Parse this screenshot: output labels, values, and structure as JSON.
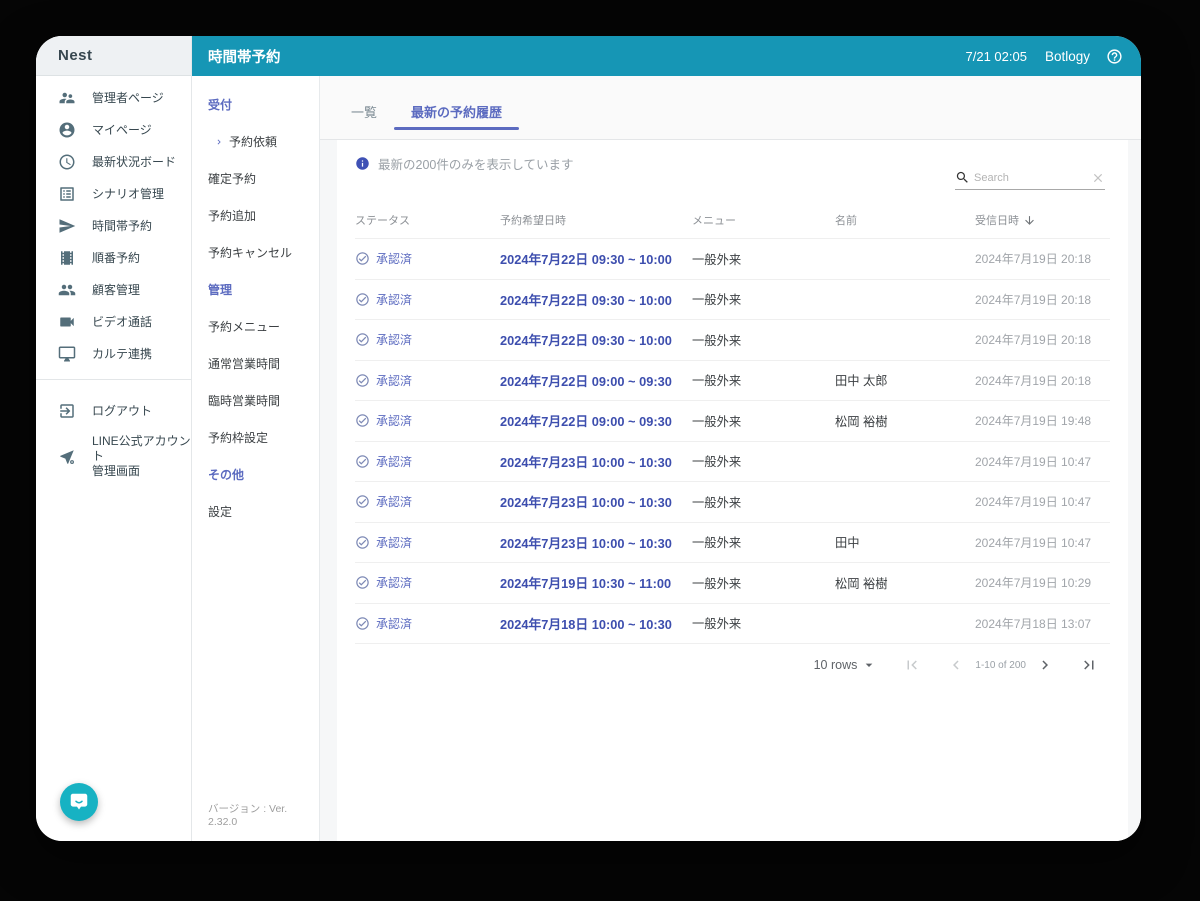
{
  "logo": "Nest",
  "topbar": {
    "title": "時間帯予約",
    "datetime": "7/21 02:05",
    "brand": "Botlogy",
    "help_icon": "help-outline-icon"
  },
  "sidebar": {
    "items": [
      {
        "icon": "supervisor-icon",
        "label": "管理者ページ"
      },
      {
        "icon": "account-circle-icon",
        "label": "マイページ"
      },
      {
        "icon": "clock-icon",
        "label": "最新状況ボード"
      },
      {
        "icon": "list-alt-icon",
        "label": "シナリオ管理"
      },
      {
        "icon": "send-icon",
        "label": "時間帯予約"
      },
      {
        "icon": "theaters-icon",
        "label": "順番予約"
      },
      {
        "icon": "people-icon",
        "label": "顧客管理"
      },
      {
        "icon": "videocam-icon",
        "label": "ビデオ通話"
      },
      {
        "icon": "desktop-icon",
        "label": "カルテ連携"
      }
    ],
    "footer_items": [
      {
        "icon": "logout-icon",
        "label": "ログアウト"
      },
      {
        "icon": "line-admin-icon",
        "label": "LINE公式アカウント\n管理画面"
      }
    ]
  },
  "submenu": {
    "sections": [
      {
        "title": "受付",
        "items": [
          {
            "label": "予約依頼",
            "selected": true
          },
          {
            "label": "確定予約",
            "selected": false
          },
          {
            "label": "予約追加",
            "selected": false
          },
          {
            "label": "予約キャンセル",
            "selected": false
          }
        ]
      },
      {
        "title": "管理",
        "items": [
          {
            "label": "予約メニュー",
            "selected": false
          },
          {
            "label": "通常営業時間",
            "selected": false
          },
          {
            "label": "臨時営業時間",
            "selected": false
          },
          {
            "label": "予約枠設定",
            "selected": false
          }
        ]
      },
      {
        "title": "その他",
        "items": [
          {
            "label": "設定",
            "selected": false
          }
        ]
      }
    ],
    "version": "バージョン : Ver. 2.32.0"
  },
  "tabs": [
    {
      "label": "一覧",
      "active": false
    },
    {
      "label": "最新の予約履歴",
      "active": true
    }
  ],
  "notice": "最新の200件のみを表示しています",
  "search": {
    "placeholder": "Search",
    "icons": [
      "search-icon",
      "clear-icon"
    ]
  },
  "table": {
    "headers": [
      "ステータス",
      "予約希望日時",
      "メニュー",
      "名前",
      "受信日時"
    ],
    "sorted_by": "受信日時",
    "sort_direction": "desc",
    "status_icon": "check-circle-icon",
    "rows": [
      {
        "status": "承認済",
        "datetime": "2024年7月22日 09:30 ~ 10:00",
        "menu": "一般外来",
        "name": "",
        "received": "2024年7月19日 20:18"
      },
      {
        "status": "承認済",
        "datetime": "2024年7月22日 09:30 ~ 10:00",
        "menu": "一般外来",
        "name": "",
        "received": "2024年7月19日 20:18"
      },
      {
        "status": "承認済",
        "datetime": "2024年7月22日 09:30 ~ 10:00",
        "menu": "一般外来",
        "name": "",
        "received": "2024年7月19日 20:18"
      },
      {
        "status": "承認済",
        "datetime": "2024年7月22日 09:00 ~ 09:30",
        "menu": "一般外来",
        "name": "田中 太郎",
        "received": "2024年7月19日 20:18"
      },
      {
        "status": "承認済",
        "datetime": "2024年7月22日 09:00 ~ 09:30",
        "menu": "一般外来",
        "name": "松岡 裕樹",
        "received": "2024年7月19日 19:48"
      },
      {
        "status": "承認済",
        "datetime": "2024年7月23日 10:00 ~ 10:30",
        "menu": "一般外来",
        "name": "",
        "received": "2024年7月19日 10:47"
      },
      {
        "status": "承認済",
        "datetime": "2024年7月23日 10:00 ~ 10:30",
        "menu": "一般外来",
        "name": "",
        "received": "2024年7月19日 10:47"
      },
      {
        "status": "承認済",
        "datetime": "2024年7月23日 10:00 ~ 10:30",
        "menu": "一般外来",
        "name": "田中",
        "received": "2024年7月19日 10:47"
      },
      {
        "status": "承認済",
        "datetime": "2024年7月19日 10:30 ~ 11:00",
        "menu": "一般外来",
        "name": "松岡 裕樹",
        "received": "2024年7月19日 10:29"
      },
      {
        "status": "承認済",
        "datetime": "2024年7月18日 10:00 ~ 10:30",
        "menu": "一般外来",
        "name": "",
        "received": "2024年7月18日 13:07"
      }
    ]
  },
  "pagination": {
    "rows_label": "10 rows",
    "range": "1-10 of 200"
  },
  "colors": {
    "topbar_teal": "#1696b5",
    "accent_indigo": "#5c6bc0",
    "datetime_indigo": "#3d4eae",
    "fab_teal": "#17b2c3"
  }
}
